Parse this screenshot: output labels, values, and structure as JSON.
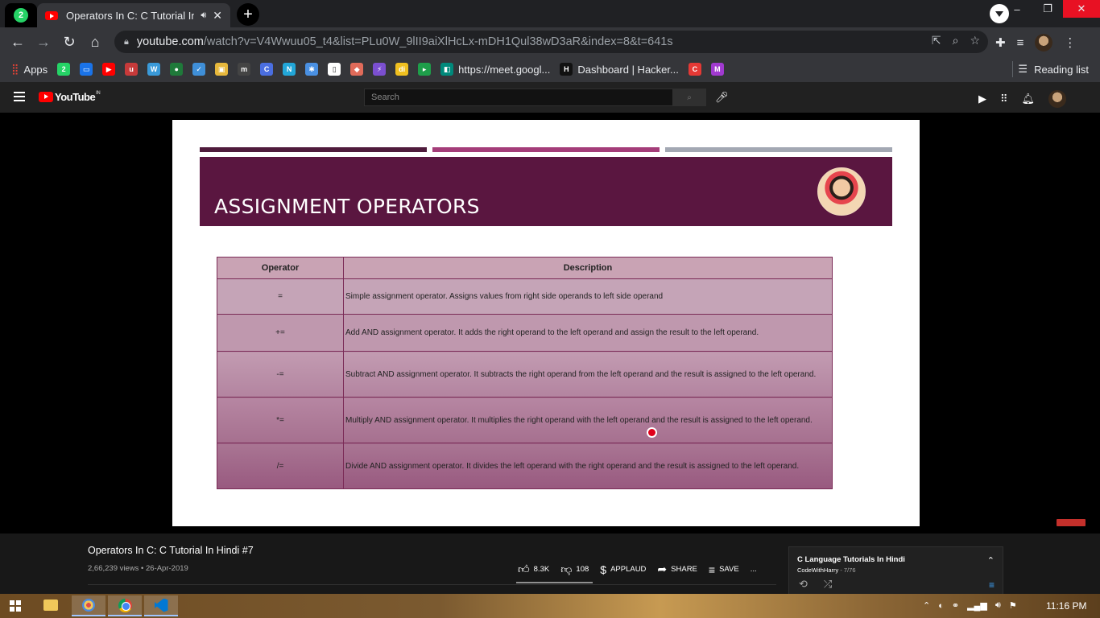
{
  "browser": {
    "whatsapp_tab_badge": "2",
    "active_tab": {
      "title": "Operators In C: C Tutorial In",
      "audio_icon": "speaker-icon",
      "close_icon": "close-icon"
    },
    "new_tab_icon": "plus-icon",
    "url_host": "youtube.com",
    "url_path": "/watch?v=V4Wwuu05_t4&list=PLu0W_9lII9aiXlHcLx-mDH1Qul38wD3aR&index=8&t=641s",
    "window_controls": {
      "minimize": "–",
      "restore": "❐",
      "close": "✕"
    }
  },
  "bookmarks": {
    "apps_label": "Apps",
    "items": [
      {
        "icon": "whatsapp-icon",
        "color": "#25d366",
        "glyph": "2",
        "label": ""
      },
      {
        "icon": "calendar-icon",
        "color": "#1a73e8",
        "glyph": "▭",
        "label": ""
      },
      {
        "icon": "youtube-icon",
        "color": "#ff0000",
        "glyph": "▶",
        "label": ""
      },
      {
        "icon": "udemy-icon",
        "color": "#c73a3a",
        "glyph": "u",
        "label": ""
      },
      {
        "icon": "w-icon",
        "color": "#3a9ad9",
        "glyph": "W",
        "label": ""
      },
      {
        "icon": "green-circle-icon",
        "color": "#1f7a3a",
        "glyph": "●",
        "label": ""
      },
      {
        "icon": "bookmark-blue-icon",
        "color": "#3f8fd8",
        "glyph": "✓",
        "label": ""
      },
      {
        "icon": "photo-icon",
        "color": "#e7b83c",
        "glyph": "▣",
        "label": ""
      },
      {
        "icon": "m-icon",
        "color": "#444444",
        "glyph": "m",
        "label": ""
      },
      {
        "icon": "c-icon",
        "color": "#4a6ee0",
        "glyph": "C",
        "label": ""
      },
      {
        "icon": "n-icon",
        "color": "#22a6d8",
        "glyph": "N",
        "label": ""
      },
      {
        "icon": "brain-icon",
        "color": "#4a90e2",
        "glyph": "✱",
        "label": ""
      },
      {
        "icon": "doc-icon",
        "color": "#ffffff",
        "glyph": "▯",
        "label": ""
      },
      {
        "icon": "cube-icon",
        "color": "#e06b5a",
        "glyph": "◆",
        "label": ""
      },
      {
        "icon": "bolt-icon",
        "color": "#7b4fd0",
        "glyph": "⚡",
        "label": ""
      },
      {
        "icon": "di-icon",
        "color": "#f0c020",
        "glyph": "di",
        "label": ""
      },
      {
        "icon": "play-green-icon",
        "color": "#1e9e4a",
        "glyph": "▸",
        "label": ""
      },
      {
        "icon": "meet-icon",
        "color": "#00897b",
        "glyph": "◧",
        "label": "https://meet.googl..."
      },
      {
        "icon": "hackerrank-icon",
        "color": "#111111",
        "glyph": "H",
        "label": "Dashboard | Hacker..."
      },
      {
        "icon": "red-c-icon",
        "color": "#e53935",
        "glyph": "C",
        "label": ""
      },
      {
        "icon": "m-purple-icon",
        "color": "#a13ad0",
        "glyph": "M",
        "label": ""
      }
    ],
    "reading_list": "Reading list"
  },
  "youtube": {
    "logo_text": "YouTube",
    "country": "IN",
    "search_placeholder": "Search"
  },
  "slide": {
    "title": "ASSIGNMENT OPERATORS",
    "bar_colors": [
      "#4f1b3c",
      "#a43d79",
      "#a3a8b3"
    ],
    "banner_color": "#5a1640",
    "table": {
      "headers": [
        "Operator",
        "Description"
      ],
      "rows": [
        {
          "op": "=",
          "desc": "Simple assignment operator. Assigns values from right side operands to left side operand"
        },
        {
          "op": "+=",
          "desc": "Add AND assignment operator. It adds the right operand to the left operand and assign the result to the left operand."
        },
        {
          "op": "-=",
          "desc": "Subtract AND assignment operator. It subtracts the right operand from the left operand and the result is assigned to the left operand."
        },
        {
          "op": "*=",
          "desc": "Multiply AND assignment operator. It multiplies the right operand with the left operand and the result is assigned to the left operand."
        },
        {
          "op": "/=",
          "desc": "Divide AND assignment operator. It divides the left operand with the right operand and the result is assigned to the left operand."
        }
      ]
    }
  },
  "video": {
    "title": "Operators In C: C Tutorial In Hindi #7",
    "meta": "2,66,239 views • 26-Apr-2019",
    "likes": "8.3K",
    "dislikes": "108",
    "applaud": "APPLAUD",
    "share": "SHARE",
    "save": "SAVE",
    "more": "..."
  },
  "playlist": {
    "title": "C Language Tutorials In Hindi",
    "channel": "CodeWithHarry",
    "position": " - 7/76"
  },
  "taskbar": {
    "clock": "11:16 PM"
  }
}
